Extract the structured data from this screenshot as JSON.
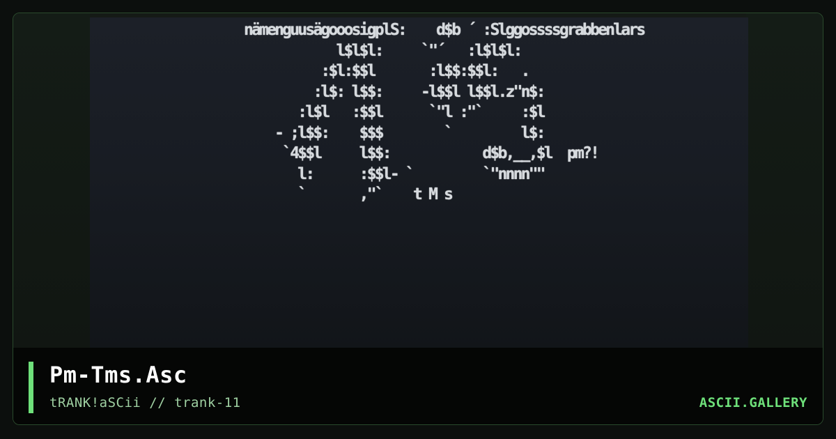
{
  "artwork": {
    "ascii_art": "                    nämenguusägooosigplS:    d$b ´ :Slggossssgrabbenlars\n                                l$l$l:     `\"´   :l$l$l:\n                              :$l:$$l       :l$$:$$l:   .\n                             :l$: l$$:     -l$$l l$$l.z\"n$:\n                           :l$l   :$$l      `\"l :\"`     :$l\n                        - ;l$$:    $$$        `         l$:\n                         `4$$l     l$$:            d$b,__,$l  pm?!\n                           l:      :$$l- `         `\"nnnn\"\"\n                           `       ,\"`    t M s"
  },
  "caption": {
    "title": "Pm-Tms.Asc",
    "subtitle": "tRANK!aSCii // trank-11",
    "brand": "ASCII.GALLERY"
  },
  "colors": {
    "accent": "#6ee07a",
    "frame_border": "#2a4a2c",
    "caption_bg": "#050605",
    "ascii_text": "#d6dade"
  }
}
